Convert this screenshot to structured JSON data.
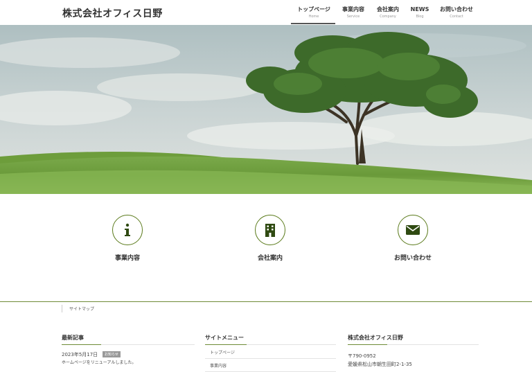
{
  "site": {
    "title": "株式会社オフィス日野"
  },
  "nav": {
    "items": [
      {
        "label": "トップページ",
        "sub": "Home"
      },
      {
        "label": "事業内容",
        "sub": "Service"
      },
      {
        "label": "会社案内",
        "sub": "Company"
      },
      {
        "label": "NEWS",
        "sub": "Blog"
      },
      {
        "label": "お問い合わせ",
        "sub": "Contact"
      }
    ]
  },
  "features": [
    {
      "label": "事業内容",
      "icon": "info-icon"
    },
    {
      "label": "会社案内",
      "icon": "building-icon"
    },
    {
      "label": "お問い合わせ",
      "icon": "envelope-icon"
    }
  ],
  "breadcrumb": {
    "current": "サイトマップ"
  },
  "columns": {
    "news": {
      "title": "最新記事",
      "items": [
        {
          "date": "2023年5月17日",
          "category": "お知らせ",
          "title": "ホームページをリニューアルしました。"
        }
      ]
    },
    "menu": {
      "title": "サイトメニュー",
      "items": [
        "トップページ",
        "事業内容"
      ]
    },
    "company": {
      "title": "株式会社オフィス日野",
      "zip": "〒790-0952",
      "address": "愛媛県松山市朝生田町2-1-35"
    }
  },
  "colors": {
    "accent": "#5a7a1a",
    "icon_fill": "#2f4a12"
  }
}
